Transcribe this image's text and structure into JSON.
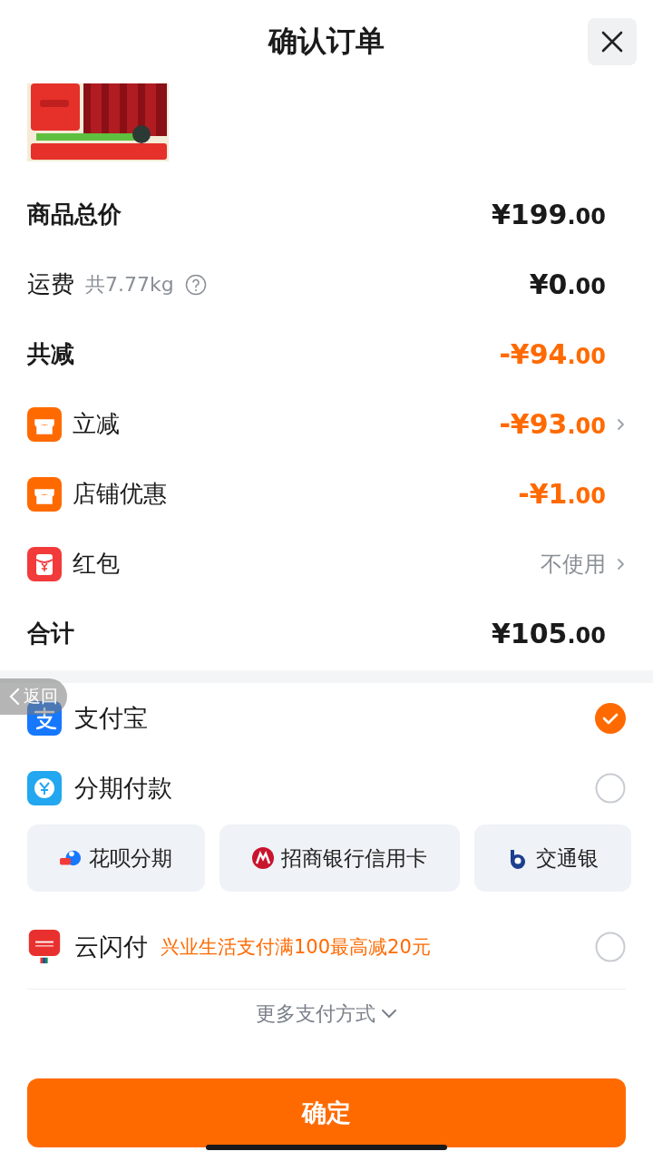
{
  "header": {
    "title": "确认订单"
  },
  "summary": [
    {
      "kind": "amount",
      "label": "商品总价",
      "amount": {
        "main": "¥199",
        "decimal": ".00"
      },
      "discount": false,
      "chevron": false
    },
    {
      "kind": "amount",
      "label": "运费",
      "note": "共7.77kg",
      "help": true,
      "amount": {
        "main": "¥0",
        "decimal": ".00"
      },
      "discount": false,
      "chevron": false
    },
    {
      "kind": "amount",
      "label": "共减",
      "amount": {
        "main": "-¥94",
        "decimal": ".00"
      },
      "discount": true,
      "chevron": false
    },
    {
      "kind": "amount",
      "label": "立减",
      "amount": {
        "main": "-¥93",
        "decimal": ".00"
      },
      "discount": true,
      "chevron": true
    },
    {
      "kind": "amount",
      "label": "店铺优惠",
      "amount": {
        "main": "-¥1",
        "decimal": ".00"
      },
      "discount": true,
      "chevron": false
    },
    {
      "kind": "text",
      "label": "红包",
      "value": "不使用",
      "chevron": true
    },
    {
      "kind": "amount",
      "label": "合计",
      "amount": {
        "main": "¥105",
        "decimal": ".00"
      },
      "discount": false,
      "chevron": false
    }
  ],
  "payments": [
    {
      "name": "支付宝",
      "selected": true
    },
    {
      "name": "分期付款",
      "selected": false,
      "options": [
        {
          "label": "花呗分期"
        },
        {
          "label": "招商银行信用卡"
        },
        {
          "label": "交通银"
        }
      ]
    },
    {
      "name": "云闪付",
      "promo": "兴业生活支付满100最高减20元",
      "selected": false
    }
  ],
  "more_payments": "更多支付方式",
  "confirm_button": "确定",
  "back_overlay": "返回"
}
